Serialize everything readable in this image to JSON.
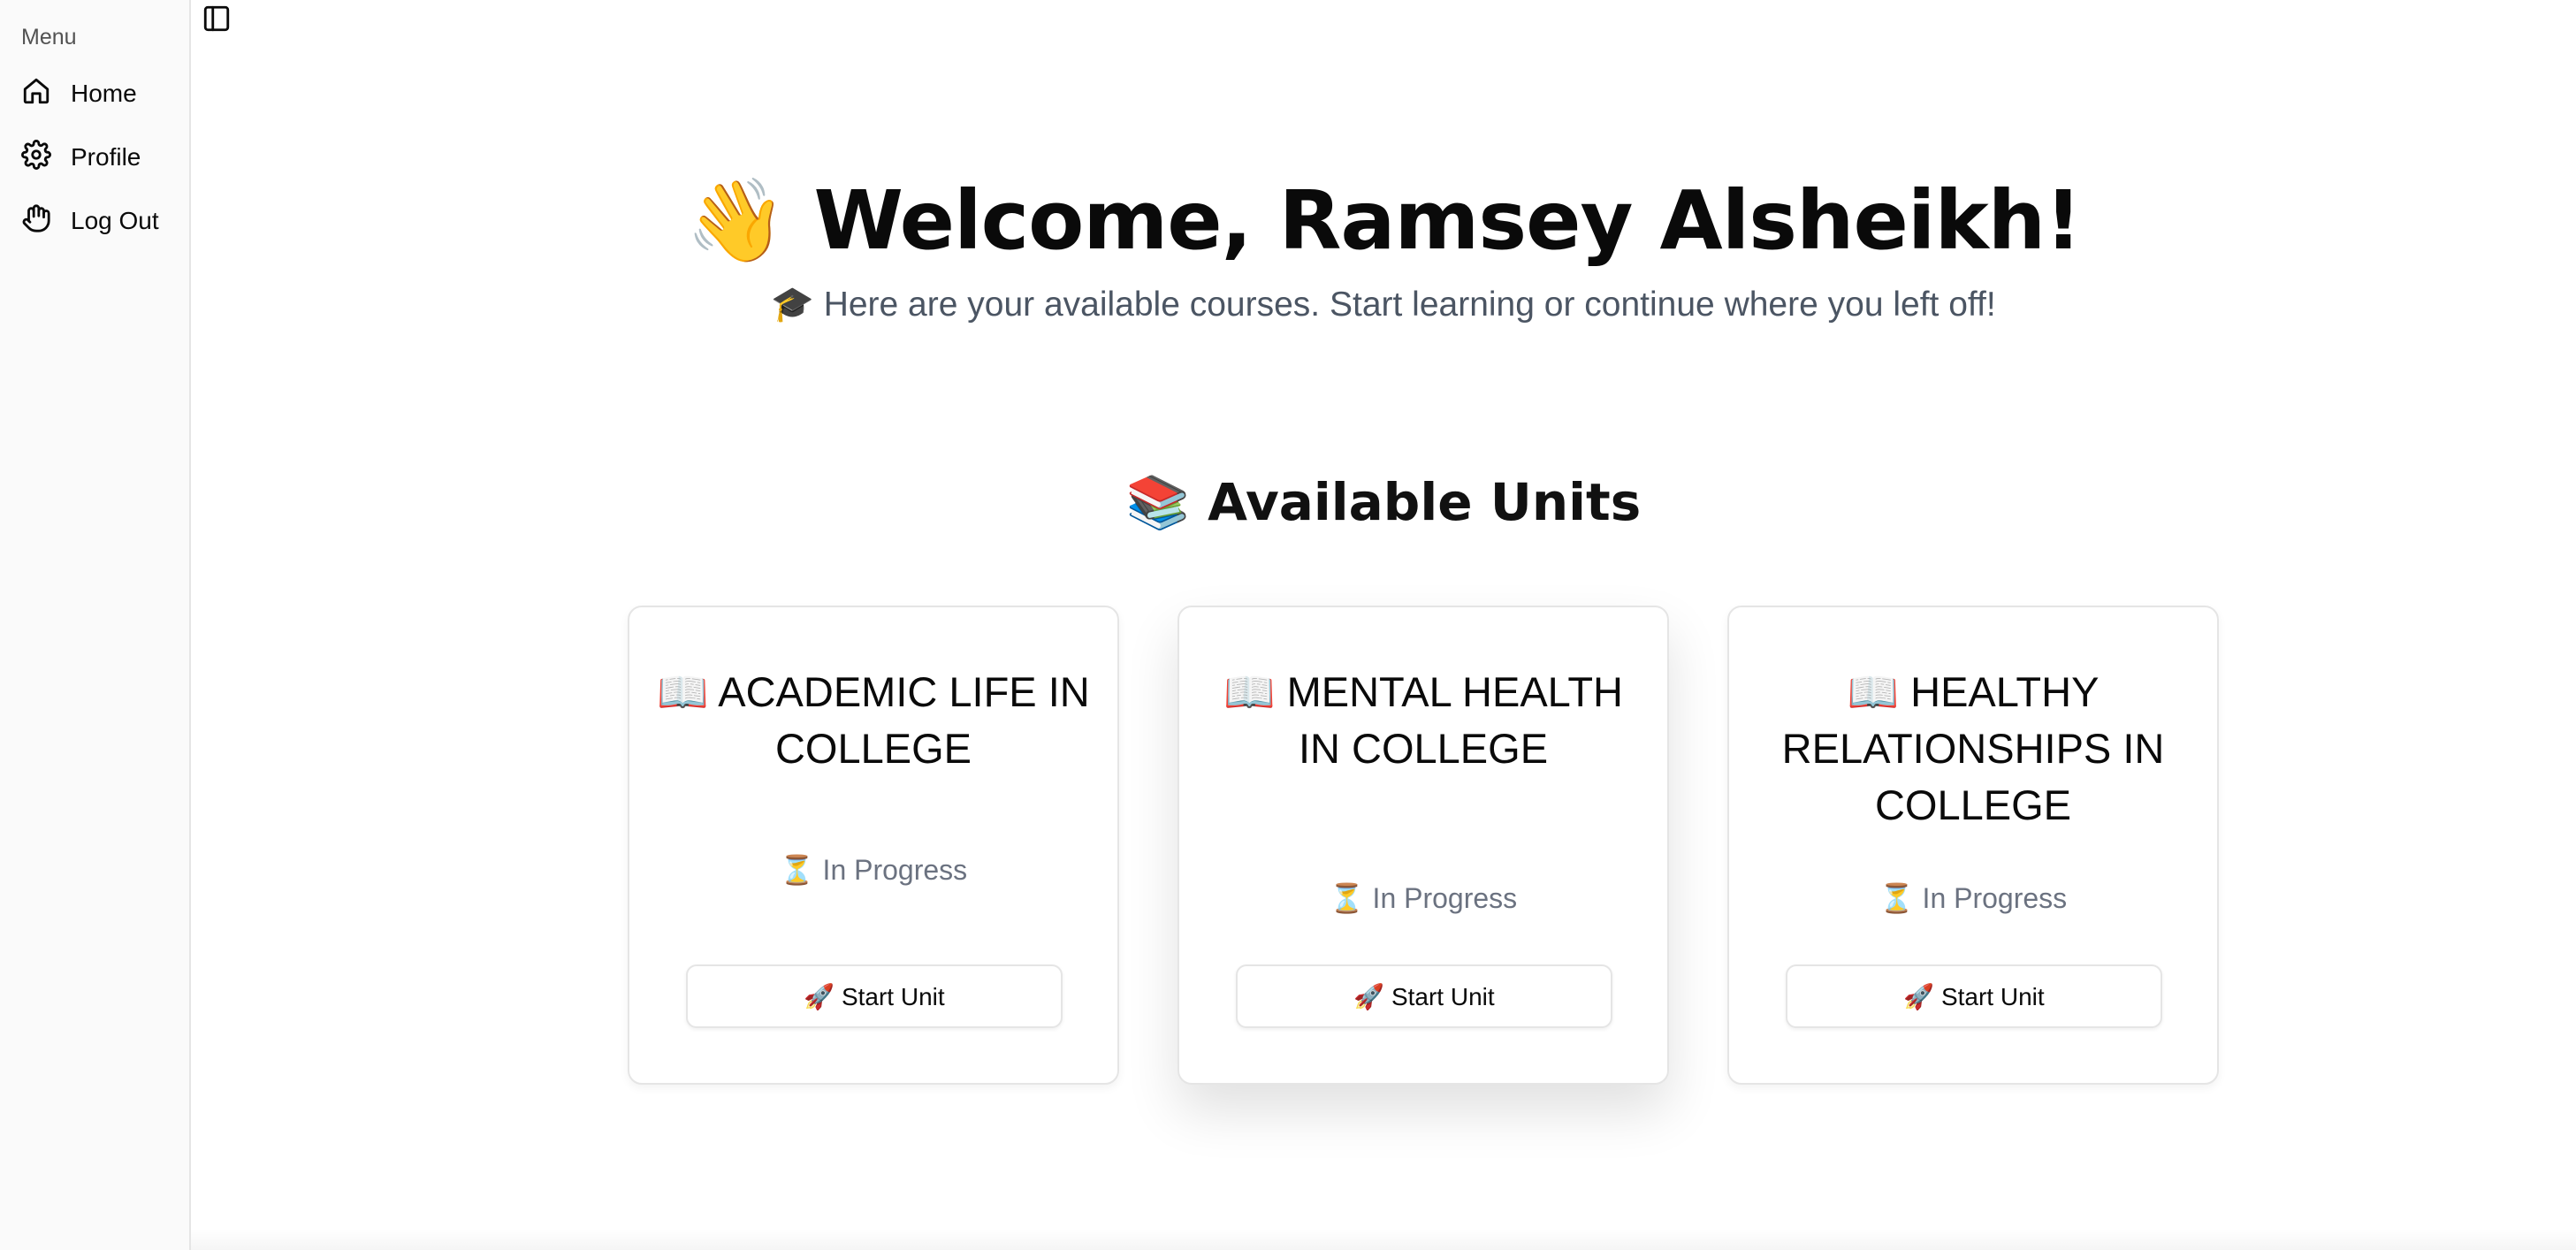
{
  "sidebar": {
    "menu_label": "Menu",
    "items": [
      {
        "label": "Home",
        "icon": "home-icon"
      },
      {
        "label": "Profile",
        "icon": "gear-icon"
      },
      {
        "label": "Log Out",
        "icon": "hand-icon"
      }
    ]
  },
  "toolbar": {
    "toggle_icon": "sidebar-toggle-icon"
  },
  "welcome": {
    "title": "👋 Welcome, Ramsey Alsheikh!",
    "subtitle": "🎓 Here are your available courses. Start learning or continue where you left off!"
  },
  "units": {
    "heading": "📚 Available Units",
    "cards": [
      {
        "title": "📖 ACADEMIC LIFE IN COLLEGE",
        "status": "⏳ In Progress",
        "button": "🚀 Start Unit"
      },
      {
        "title": "📖 MENTAL HEALTH IN COLLEGE",
        "status": "⏳ In Progress",
        "button": "🚀 Start Unit"
      },
      {
        "title": "📖 HEALTHY RELATIONSHIPS IN COLLEGE",
        "status": "⏳ In Progress",
        "button": "🚀 Start Unit"
      }
    ]
  },
  "colors": {
    "sidebar_bg": "#fafafa",
    "border": "#e5e5e5",
    "subtitle_text": "#4b5563",
    "status_text": "#6b7280"
  }
}
